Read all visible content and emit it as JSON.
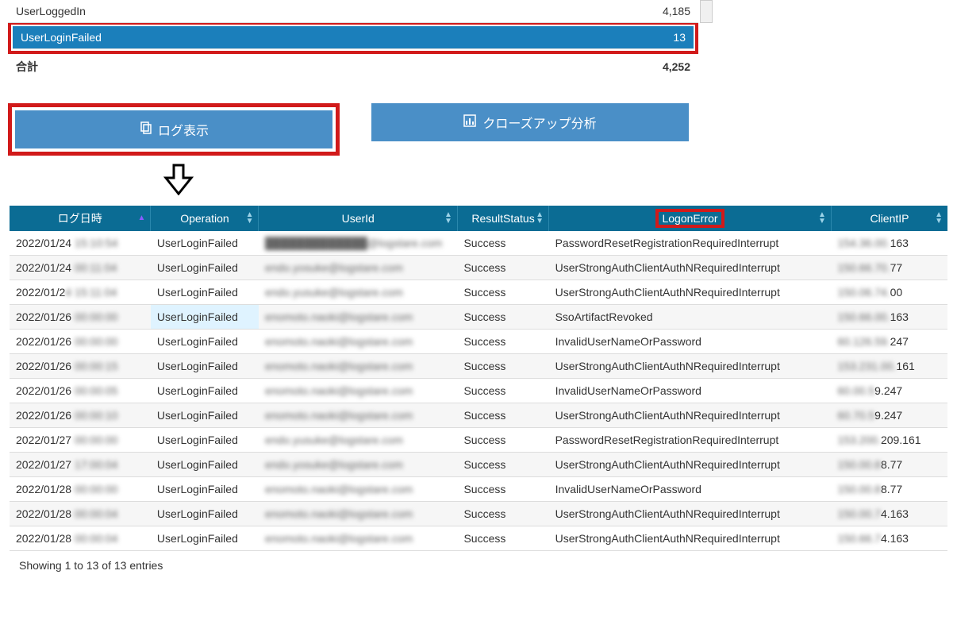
{
  "summary": {
    "rows": [
      {
        "label": "UserLoggedIn",
        "count": "4,185",
        "selected": false
      },
      {
        "label": "UserLoginFailed",
        "count": "13",
        "selected": true
      }
    ],
    "total_label": "合計",
    "total_count": "4,252"
  },
  "buttons": {
    "show_log": "ログ表示",
    "closeup": "クローズアップ分析"
  },
  "table": {
    "headers": {
      "datetime": "ログ日時",
      "operation": "Operation",
      "userid": "UserId",
      "resultstatus": "ResultStatus",
      "logonerror": "LogonError",
      "clientip": "ClientIP"
    },
    "rows": [
      {
        "dt_pre": "2022/01/24",
        "dt_mask": " 15:10:54",
        "op": "UserLoginFailed",
        "uid": "█████████████@logstare.com",
        "rs": "Success",
        "le": "PasswordResetRegistrationRequiredInterrupt",
        "ip_mask": "154.36.00.",
        "ip_tail": "163",
        "hl": false
      },
      {
        "dt_pre": "2022/01/24",
        "dt_mask": " 00:11:04",
        "op": "UserLoginFailed",
        "uid": "endo.yosuke@logstare.com",
        "rs": "Success",
        "le": "UserStrongAuthClientAuthNRequiredInterrupt",
        "ip_mask": "150.66.70.",
        "ip_tail": "77",
        "hl": false
      },
      {
        "dt_pre": "2022/01/2",
        "dt_mask": "4 15:11:04",
        "op": "UserLoginFailed",
        "uid": "endo.yusuke@logstare.com",
        "rs": "Success",
        "le": "UserStrongAuthClientAuthNRequiredInterrupt",
        "ip_mask": "150.06.74.",
        "ip_tail": "00",
        "hl": false
      },
      {
        "dt_pre": "2022/01/26",
        "dt_mask": " 00:00:00",
        "op": "UserLoginFailed",
        "uid": "enomoto.naoki@logstare.com",
        "rs": "Success",
        "le": "SsoArtifactRevoked",
        "ip_mask": "150.66.00.",
        "ip_tail": "163",
        "hl": true
      },
      {
        "dt_pre": "2022/01/26",
        "dt_mask": " 00:00:00",
        "op": "UserLoginFailed",
        "uid": "enomoto.naoki@logstare.com",
        "rs": "Success",
        "le": "InvalidUserNameOrPassword",
        "ip_mask": "60.126.59.",
        "ip_tail": "247",
        "hl": false
      },
      {
        "dt_pre": "2022/01/26",
        "dt_mask": " 00:00:15",
        "op": "UserLoginFailed",
        "uid": "enomoto.naoki@logstare.com",
        "rs": "Success",
        "le": "UserStrongAuthClientAuthNRequiredInterrupt",
        "ip_mask": "153.231.00.",
        "ip_tail": "161",
        "hl": false
      },
      {
        "dt_pre": "2022/01/26",
        "dt_mask": " 00:00:05",
        "op": "UserLoginFailed",
        "uid": "enomoto.naoki@logstare.com",
        "rs": "Success",
        "le": "InvalidUserNameOrPassword",
        "ip_mask": "60.00.5",
        "ip_tail": "9.247",
        "hl": false
      },
      {
        "dt_pre": "2022/01/26",
        "dt_mask": " 00:00:10",
        "op": "UserLoginFailed",
        "uid": "enomoto.naoki@logstare.com",
        "rs": "Success",
        "le": "UserStrongAuthClientAuthNRequiredInterrupt",
        "ip_mask": "60.70.5",
        "ip_tail": "9.247",
        "hl": false
      },
      {
        "dt_pre": "2022/01/27",
        "dt_mask": " 00:00:00",
        "op": "UserLoginFailed",
        "uid": "endo.yusuke@logstare.com",
        "rs": "Success",
        "le": "PasswordResetRegistrationRequiredInterrupt",
        "ip_mask": "153.200.",
        "ip_tail": "209.161",
        "hl": false
      },
      {
        "dt_pre": "2022/01/27",
        "dt_mask": " 17:00:04",
        "op": "UserLoginFailed",
        "uid": "endo.yosuke@logstare.com",
        "rs": "Success",
        "le": "UserStrongAuthClientAuthNRequiredInterrupt",
        "ip_mask": "150.00.8",
        "ip_tail": "8.77",
        "hl": false
      },
      {
        "dt_pre": "2022/01/28",
        "dt_mask": " 00:00:00",
        "op": "UserLoginFailed",
        "uid": "enomoto.naoki@logstare.com",
        "rs": "Success",
        "le": "InvalidUserNameOrPassword",
        "ip_mask": "150.00.8",
        "ip_tail": "8.77",
        "hl": false
      },
      {
        "dt_pre": "2022/01/28",
        "dt_mask": " 00:00:04",
        "op": "UserLoginFailed",
        "uid": "enomoto.naoki@logstare.com",
        "rs": "Success",
        "le": "UserStrongAuthClientAuthNRequiredInterrupt",
        "ip_mask": "150.00.7",
        "ip_tail": "4.163",
        "hl": false
      },
      {
        "dt_pre": "2022/01/28",
        "dt_mask": " 00:00:04",
        "op": "UserLoginFailed",
        "uid": "enomoto.naoki@logstare.com",
        "rs": "Success",
        "le": "UserStrongAuthClientAuthNRequiredInterrupt",
        "ip_mask": "150.66.7",
        "ip_tail": "4.163",
        "hl": false
      }
    ],
    "info": "Showing 1 to 13 of 13 entries"
  }
}
